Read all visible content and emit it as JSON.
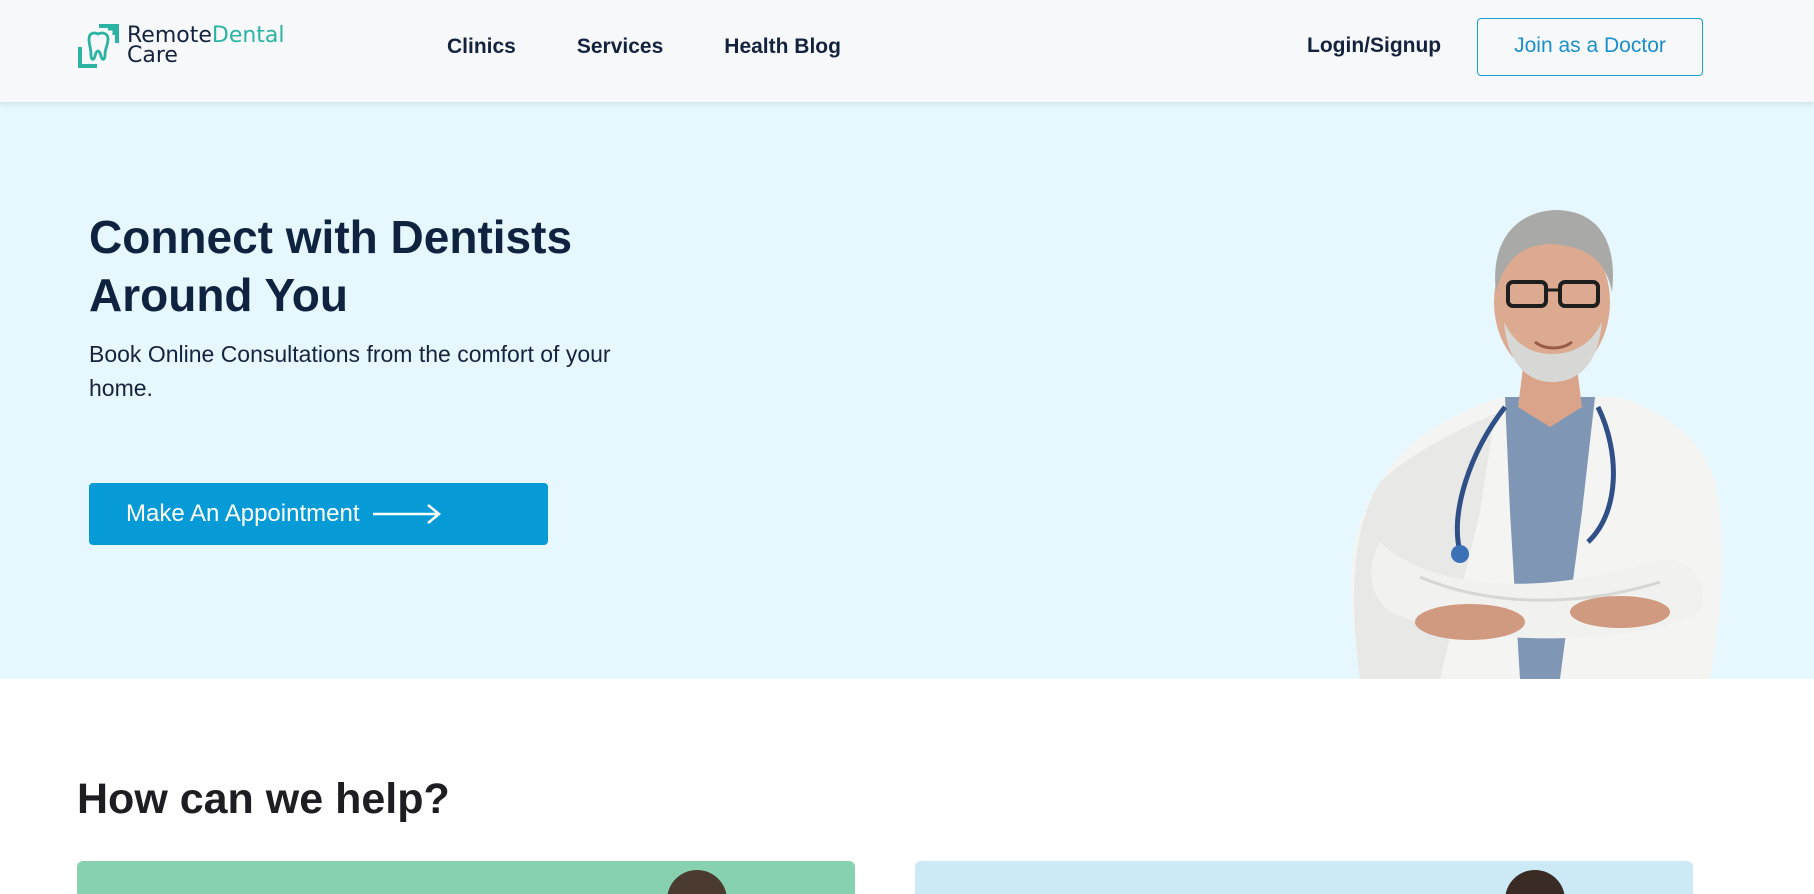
{
  "header": {
    "logo": {
      "word1": "Remote",
      "word2": "Dental",
      "word3": "Care"
    },
    "nav": [
      {
        "label": "Clinics"
      },
      {
        "label": "Services"
      },
      {
        "label": "Health Blog"
      }
    ],
    "login_label": "Login/Signup",
    "join_label": "Join as a Doctor"
  },
  "hero": {
    "title": "Connect with Dentists Around You",
    "subtitle": "Book Online Consultations from the comfort of your home.",
    "cta_label": "Make An Appointment"
  },
  "help": {
    "title": "How can we help?"
  },
  "colors": {
    "accent": "#069bd6",
    "brand_teal": "#2bb3a3",
    "hero_bg": "#e6f7fd",
    "card_green": "#87d1b1",
    "card_blue": "#cbeaf5"
  },
  "icons": [
    "tooth-logo-icon",
    "arrow-right-icon"
  ]
}
